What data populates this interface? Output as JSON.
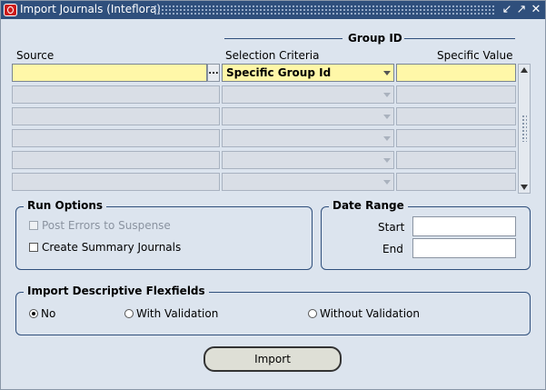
{
  "window": {
    "title": "Import Journals (Inteflora)",
    "buttons": [
      "↙",
      "↗",
      "✕"
    ]
  },
  "headers": {
    "group_id": "Group ID",
    "source": "Source",
    "selection_criteria": "Selection Criteria",
    "specific_value": "Specific Value"
  },
  "rows": [
    {
      "source": "",
      "criteria": "Specific Group Id",
      "value": ""
    },
    {
      "source": "",
      "criteria": "",
      "value": ""
    },
    {
      "source": "",
      "criteria": "",
      "value": ""
    },
    {
      "source": "",
      "criteria": "",
      "value": ""
    },
    {
      "source": "",
      "criteria": "",
      "value": ""
    },
    {
      "source": "",
      "criteria": "",
      "value": ""
    }
  ],
  "lov_glyph": "...",
  "run_options": {
    "title": "Run Options",
    "post_errors": "Post Errors to Suspense",
    "create_summary": "Create Summary Journals"
  },
  "date_range": {
    "title": "Date Range",
    "start_label": "Start",
    "end_label": "End",
    "start_value": "",
    "end_value": ""
  },
  "flexfields": {
    "title": "Import Descriptive Flexfields",
    "options": [
      "No",
      "With Validation",
      "Without Validation"
    ],
    "selected": "No"
  },
  "import_button": "Import",
  "colors": {
    "titlebar": "#2f4f7c",
    "background": "#dce4ee",
    "active_field": "#fff7a8"
  }
}
